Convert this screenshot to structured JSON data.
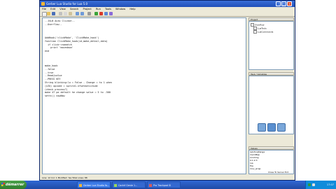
{
  "window": {
    "title": "Gerber Lua Studio for Lua 5.0"
  },
  "menu": [
    "File",
    "Edit",
    "View",
    "Search",
    "Project",
    "Run",
    "Tools",
    "Window",
    "Help"
  ],
  "editor": {
    "lines": [
      "--ISLB Auto Clicker--",
      "--Overflow--",
      "",
      "",
      "AddHook('clickMake', 'ClickMake_hook')",
      "function ClickMake_hook(id,make,detail,data)",
      "  if click~=nomatch",
      "    print 'movedown'",
      "end",
      "",
      "",
      "",
      "make_hook",
      "--false",
      "--true",
      "--Readjvalue",
      "--PRESS KEY",
      "String blinking:lo = False - Change = to 1 when",
      "(LEO) opcode = sprite1.nfseteatiitude",
      "(check process?)",
      "make 47 pe default he change value = 5 to -500",
      "settv() nowNow"
    ]
  },
  "project": {
    "header": "Project",
    "items": [
      "Overflow",
      "LuaTools",
      "LuaCommands"
    ]
  },
  "run": {
    "header": "Task / Variables"
  },
  "locals": {
    "header": "Values",
    "items": [
      "isActiveRange",
      "memMap",
      "scrolling",
      "0.1.2.3",
      "lua",
      "fire",
      "mov_wrap"
    ],
    "status_link": "Close To Server Ext"
  },
  "statusbar": {
    "text": "Line: 12  Col: 1   Modified: Yes   Total Lines: 88"
  },
  "taskbar": {
    "start_label": "démarrer",
    "tasks": [
      "Gerber Lua Studio fo...",
      "Caché Genie 1...",
      "Pro Trackpad SI"
    ],
    "clock": "17:07"
  }
}
